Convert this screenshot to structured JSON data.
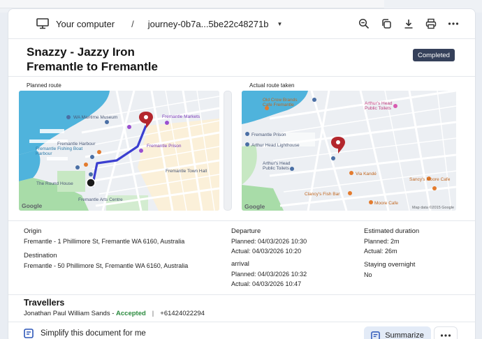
{
  "toolbar": {
    "location": "Your computer",
    "separator": "/",
    "file_name": "journey-0b7a...5be22c48271b"
  },
  "header": {
    "title_line1": "Snazzy - Jazzy Iron",
    "title_line2": "Fremantle to Fremantle",
    "status": "Completed"
  },
  "maps": {
    "planned_label": "Planned route",
    "actual_label": "Actual route taken",
    "planned_pois": [
      "WA Maritime Museum",
      "Fremantle Markets",
      "Fremantle Prison",
      "Fremantle Arts Centre",
      "The Round House",
      "Fremantle Fishing Boat Harbour",
      "Fremantle Harbour"
    ],
    "actual_pois": [
      "Old Crow Brands Cafe",
      "Fremantle Prison",
      "Arthur Head Public Toilets",
      "Arthur's Head Public Toilets",
      "Via Kandé",
      "Clancy's Fish Bar",
      "Sancy's Moore Cafe",
      "Moore Cafe"
    ],
    "google_logo": "Google",
    "map_data": "Map data ©2015 Google"
  },
  "details": {
    "origin_label": "Origin",
    "origin_value": "Fremantle - 1 Phillimore St, Fremantle WA 6160, Australia",
    "destination_label": "Destination",
    "destination_value": "Fremantle - 50 Phillimore St, Fremantle WA 6160, Australia",
    "departure_label": "Departure",
    "departure_planned": "Planned: 04/03/2026 10:30",
    "departure_actual": "Actual:  04/03/2026 10:20",
    "arrival_label": "arrival",
    "arrival_planned": "Planned: 04/03/2026 10:32",
    "arrival_actual": "Actual:  04/03/2026 10:47",
    "duration_label": "Estimated duration",
    "duration_planned": "Planned:  2m",
    "duration_actual": "Actual:   26m",
    "overnight_label": "Staying overnight",
    "overnight_value": "No"
  },
  "travellers": {
    "title": "Travellers",
    "name": "Jonathan Paul William Sands",
    "dash": " - ",
    "status": "Accepted",
    "pipe": "|",
    "phone": "+61424022294"
  },
  "bottom": {
    "simplify": "Simplify this document for me",
    "summarize": "Summarize"
  },
  "colors": {
    "route": "#3b3fd0",
    "pin": "#b3262d",
    "water": "#4fb3dc",
    "badge": "#35405a",
    "accepted": "#2b8a3e"
  }
}
